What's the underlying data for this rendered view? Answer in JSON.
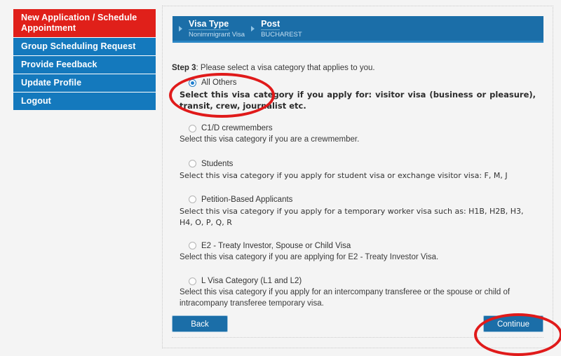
{
  "sidebar": {
    "items": [
      {
        "label": "New Application / Schedule Appointment",
        "style": "red"
      },
      {
        "label": "Group Scheduling Request",
        "style": "blue"
      },
      {
        "label": "Provide Feedback",
        "style": "blue"
      },
      {
        "label": "Update Profile",
        "style": "blue"
      },
      {
        "label": "Logout",
        "style": "blue"
      }
    ]
  },
  "breadcrumb": {
    "items": [
      {
        "label": "Visa Type",
        "value": "Nonimmigrant Visa"
      },
      {
        "label": "Post",
        "value": "BUCHAREST"
      }
    ]
  },
  "step": {
    "strong": "Step 3",
    "rest": ": Please select a visa category that applies to you."
  },
  "options": [
    {
      "title": "All Others",
      "description": "Select this visa category if you apply for: visitor visa (business or pleasure), transit, crew, journalist etc.",
      "selected": true
    },
    {
      "title": "C1/D crewmembers",
      "description": "Select this visa category if you are a crewmember.",
      "selected": false
    },
    {
      "title": "Students",
      "description": "Select this visa category if you apply for student visa or exchange visitor visa: F, M, J",
      "selected": false
    },
    {
      "title": "Petition-Based Applicants",
      "description": "Select this visa category if you apply for a temporary worker visa such as: H1B, H2B, H3, H4, O, P, Q, R",
      "selected": false
    },
    {
      "title": "E2 - Treaty Investor, Spouse or Child Visa",
      "description": "Select this visa category if you are applying for E2 - Treaty Investor Visa.",
      "selected": false
    },
    {
      "title": "L Visa Category (L1 and L2)",
      "description": "Select this visa category if you apply for an intercompany transferee or the spouse or child of intracompany transferee temporary visa.",
      "selected": false
    }
  ],
  "buttons": {
    "back": "Back",
    "continue": "Continue"
  },
  "colors": {
    "red": "#e0201a",
    "blue": "#1479bd",
    "header_blue": "#1b6ea8",
    "annotation_red": "#e01a1a"
  }
}
